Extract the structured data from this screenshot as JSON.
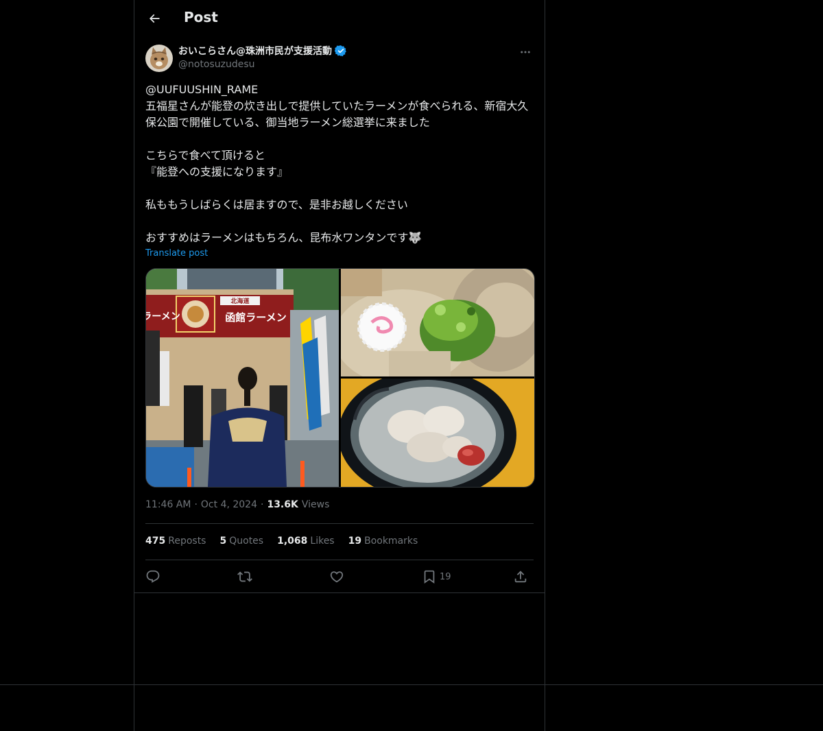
{
  "header": {
    "title": "Post"
  },
  "author": {
    "display_name": "おいこらさん@珠洲市民が支援活動",
    "handle": "@notosuzudesu",
    "verified": true
  },
  "tweet": {
    "mention": "@UUFUUSHIN_RAME",
    "body": "五福星さんが能登の炊き出しで提供していたラーメンが食べられる、新宿大久保公園で開催している、御当地ラーメン総選挙に来ました\n\nこちらで食べて頂けると\n『能登への支援になります』\n\n私ももうしばらくは居ますので、是非お越しください\n\nおすすめはラーメンはもちろん、昆布水ワンタンです",
    "emoji": "🐺",
    "translate_label": "Translate post"
  },
  "meta": {
    "time": "11:46 AM",
    "date": "Oct 4, 2024",
    "views_count": "13.6K",
    "views_label": "Views",
    "separator": "·"
  },
  "stats": {
    "reposts": {
      "count": "475",
      "label": "Reposts"
    },
    "quotes": {
      "count": "5",
      "label": "Quotes"
    },
    "likes": {
      "count": "1,068",
      "label": "Likes"
    },
    "bookmarks": {
      "count": "19",
      "label": "Bookmarks"
    }
  },
  "actions": {
    "bookmark_count": "19"
  },
  "media": {
    "stall_sign": "函館ラーメン",
    "stall_sign_region": "北海道",
    "banner_left": "ラーメン"
  },
  "colors": {
    "background": "#000000",
    "text": "#e7e9ea",
    "muted": "#71767b",
    "accent": "#1d9bf0",
    "border": "#2f3336"
  },
  "icons": [
    "back-arrow-icon",
    "verified-badge-icon",
    "more-icon",
    "reply-icon",
    "repost-icon",
    "like-icon",
    "bookmark-icon",
    "share-icon"
  ]
}
